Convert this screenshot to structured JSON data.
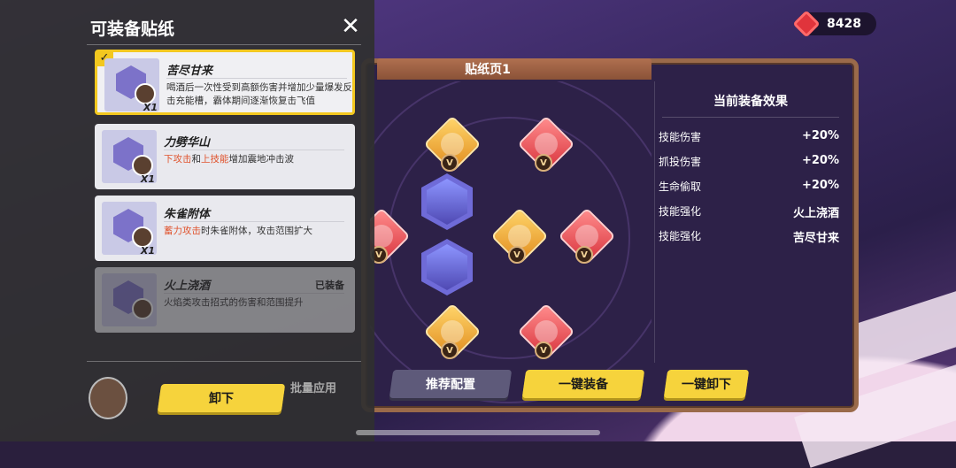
{
  "currency": {
    "amount": "8428",
    "icon": "gem-icon"
  },
  "board": {
    "title": "贴纸页1",
    "buttons": {
      "recommend": "推荐配置",
      "equip_all": "一键装备",
      "unequip_all": "一键卸下"
    }
  },
  "effects": {
    "title": "当前装备效果",
    "rows": [
      {
        "name": "技能伤害",
        "value": "+20%"
      },
      {
        "name": "抓投伤害",
        "value": "+20%"
      },
      {
        "name": "生命偷取",
        "value": "+20%"
      },
      {
        "name": "技能强化",
        "value": "火上浇酒"
      },
      {
        "name": "技能强化",
        "value": "苦尽甘来"
      }
    ]
  },
  "panel": {
    "title": "可装备贴纸",
    "cards": [
      {
        "name": "苦尽甘来",
        "desc": "喝酒后一次性受到高额伤害并增加少量爆发反击充能槽，霸体期间逐渐恢复击飞值",
        "count": "X1",
        "selected": true
      },
      {
        "name": "力劈华山",
        "desc_parts": [
          "下攻击",
          "和",
          "上技能",
          "增加震地冲击波"
        ],
        "count": "X1"
      },
      {
        "name": "朱雀附体",
        "desc_parts": [
          "蓄力攻击",
          "时朱雀附体，攻击范围扩大"
        ],
        "count": "X1"
      },
      {
        "name": "火上浇酒",
        "desc": "火焰类攻击招式的伤害和范围提升",
        "status": "已装备"
      }
    ],
    "unequip_button": "卸下",
    "batch_apply": "批量应用"
  },
  "colors": {
    "accent": "#f6d33c",
    "highlight": "#e0542e",
    "panel_bg": "#303030"
  }
}
